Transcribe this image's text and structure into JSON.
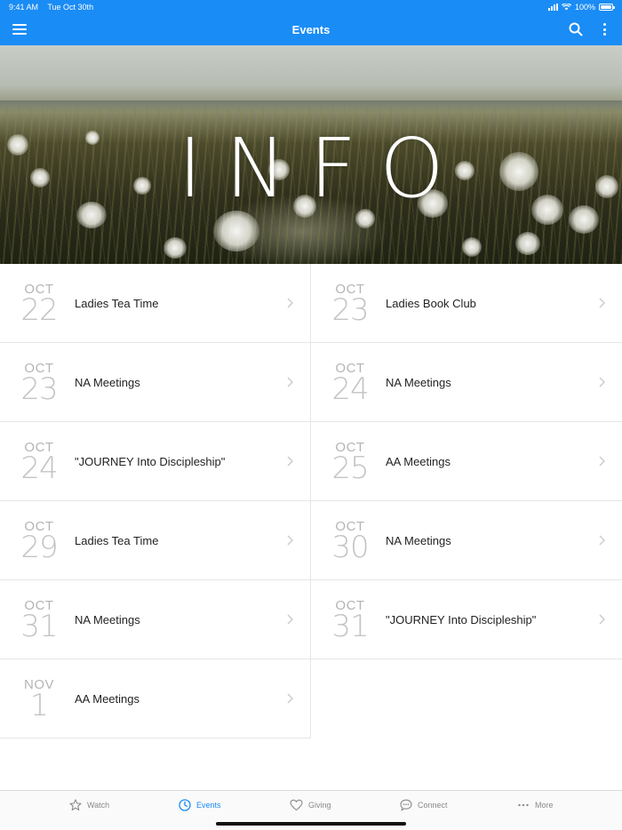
{
  "status_bar": {
    "time": "9:41 AM",
    "date": "Tue Oct 30th",
    "battery": "100%"
  },
  "nav": {
    "title": "Events"
  },
  "hero": {
    "text": "INFO"
  },
  "events": [
    {
      "month": "OCT",
      "day": "22",
      "title": "Ladies Tea Time"
    },
    {
      "month": "OCT",
      "day": "23",
      "title": "Ladies Book Club"
    },
    {
      "month": "OCT",
      "day": "23",
      "title": "NA Meetings"
    },
    {
      "month": "OCT",
      "day": "24",
      "title": "NA Meetings"
    },
    {
      "month": "OCT",
      "day": "24",
      "title": "\"JOURNEY Into Discipleship\""
    },
    {
      "month": "OCT",
      "day": "25",
      "title": "AA Meetings"
    },
    {
      "month": "OCT",
      "day": "29",
      "title": "Ladies Tea Time"
    },
    {
      "month": "OCT",
      "day": "30",
      "title": "NA Meetings"
    },
    {
      "month": "OCT",
      "day": "31",
      "title": "NA Meetings"
    },
    {
      "month": "OCT",
      "day": "31",
      "title": "\"JOURNEY Into Discipleship\""
    },
    {
      "month": "NOV",
      "day": "1",
      "title": "AA Meetings"
    }
  ],
  "tabs": [
    {
      "label": "Watch",
      "icon": "star-icon",
      "active": false
    },
    {
      "label": "Events",
      "icon": "clock-icon",
      "active": true
    },
    {
      "label": "Giving",
      "icon": "heart-icon",
      "active": false
    },
    {
      "label": "Connect",
      "icon": "chat-bubble-icon",
      "active": false
    },
    {
      "label": "More",
      "icon": "ellipsis-icon",
      "active": false
    }
  ],
  "colors": {
    "accent": "#1a8cf5",
    "inactive_tab": "#8a8a8a",
    "date_text": "#c4c4c4"
  }
}
